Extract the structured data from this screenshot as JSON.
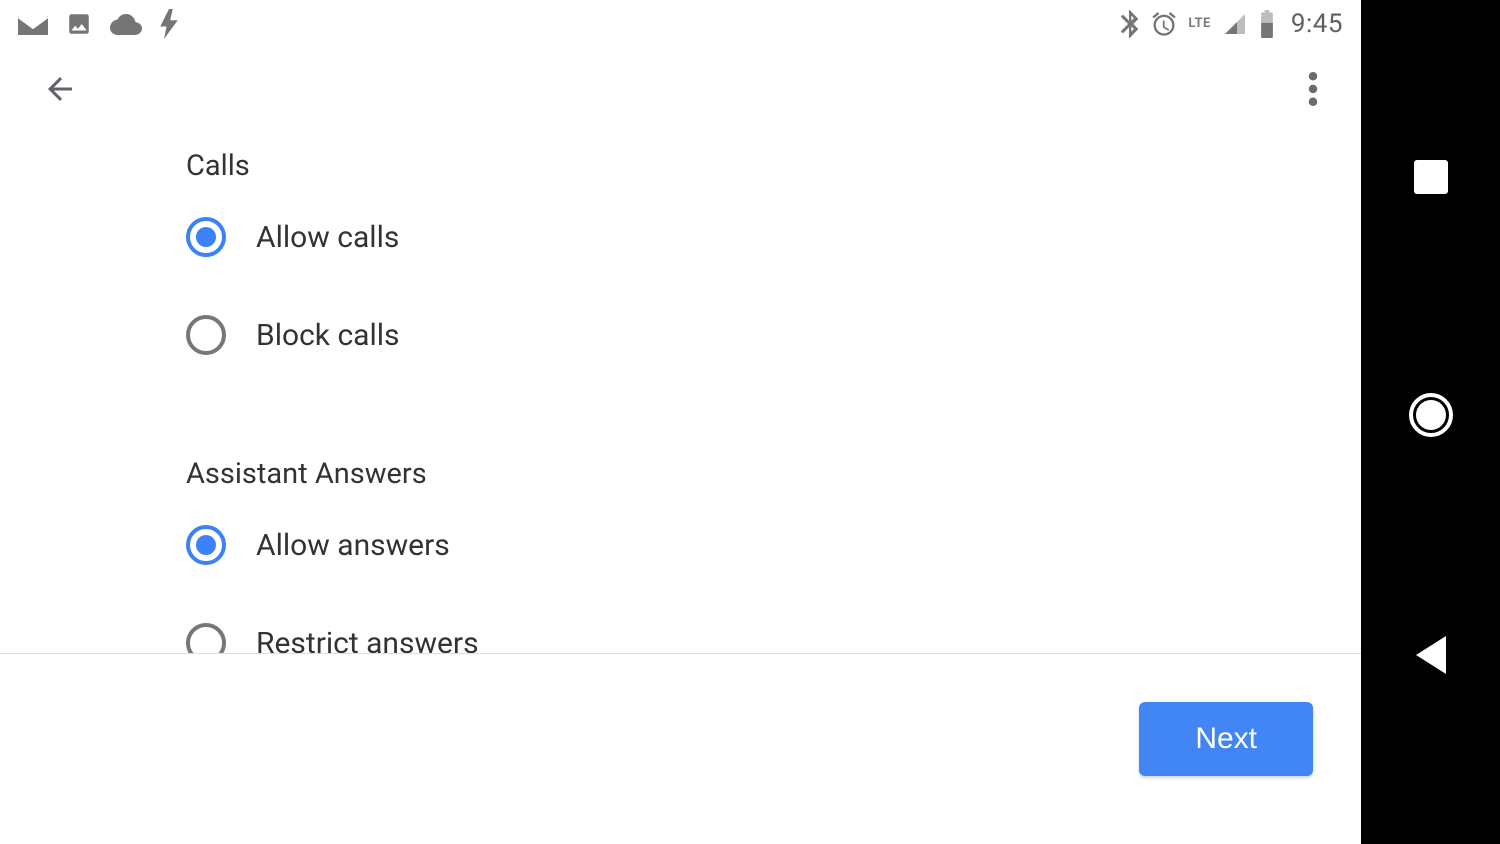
{
  "status": {
    "clock": "9:45",
    "lte_label": "LTE"
  },
  "sections": {
    "calls": {
      "title": "Calls",
      "options": [
        {
          "label": "Allow calls",
          "selected": true
        },
        {
          "label": "Block calls",
          "selected": false
        }
      ]
    },
    "assistant": {
      "title": "Assistant Answers",
      "options": [
        {
          "label": "Allow answers",
          "selected": true
        },
        {
          "label": "Restrict answers",
          "selected": false
        }
      ]
    }
  },
  "footer": {
    "next_label": "Next"
  }
}
